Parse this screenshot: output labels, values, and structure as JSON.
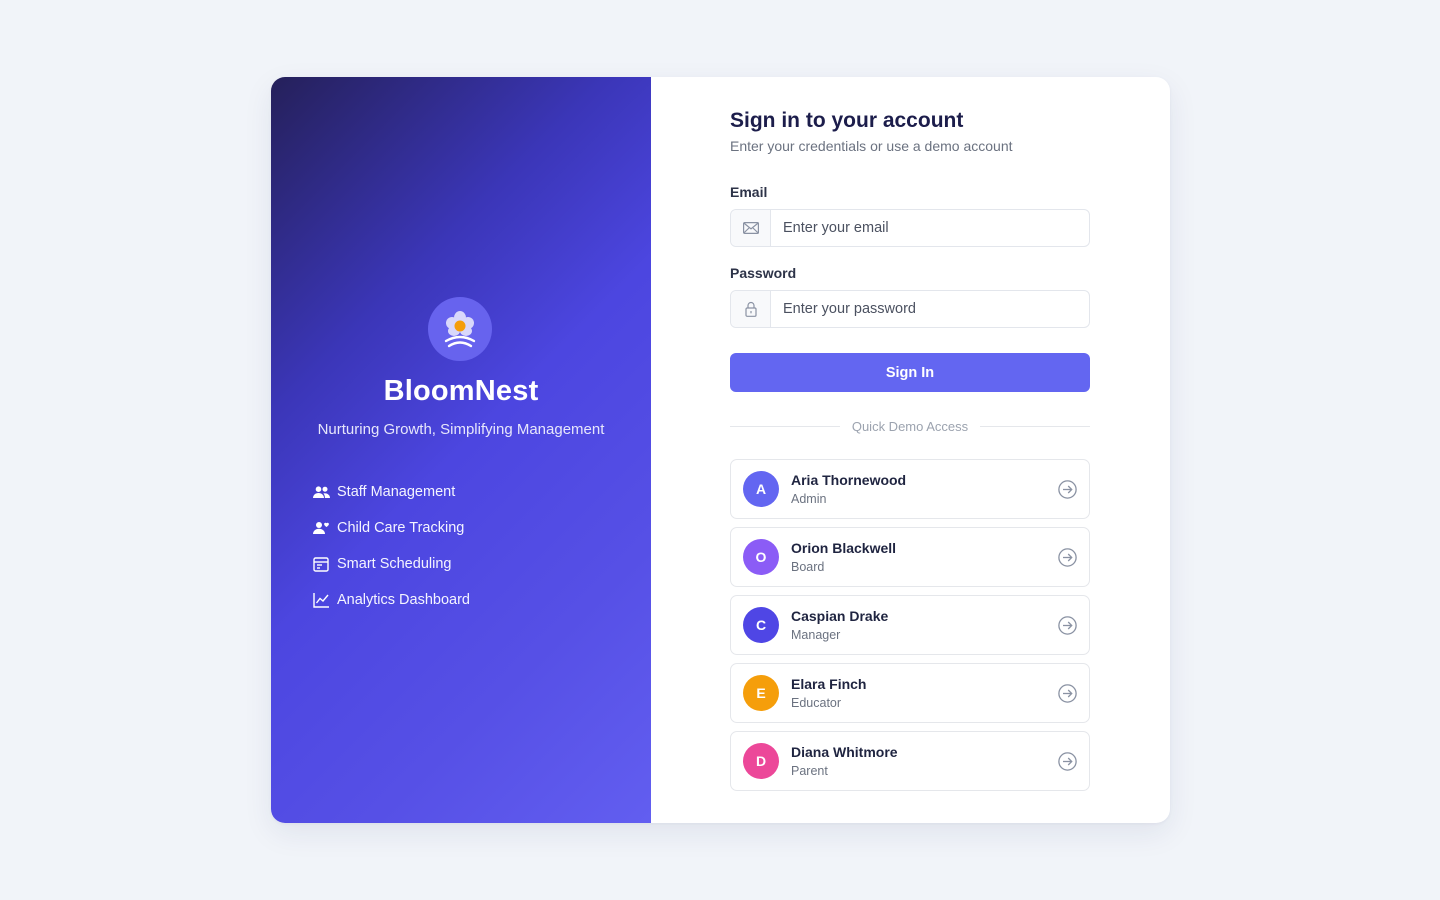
{
  "brand": {
    "name": "BloomNest",
    "tagline": "Nurturing Growth, Simplifying Management",
    "features": [
      {
        "label": "Staff Management",
        "icon": "users-icon"
      },
      {
        "label": "Child Care Tracking",
        "icon": "user-heart-icon"
      },
      {
        "label": "Smart Scheduling",
        "icon": "calendar-icon"
      },
      {
        "label": "Analytics Dashboard",
        "icon": "chart-line-icon"
      }
    ]
  },
  "form": {
    "title": "Sign in to your account",
    "subtitle": "Enter your credentials or use a demo account",
    "email": {
      "label": "Email",
      "placeholder": "Enter your email",
      "value": ""
    },
    "password": {
      "label": "Password",
      "placeholder": "Enter your password",
      "value": ""
    },
    "signin_label": "Sign In",
    "divider_label": "Quick Demo Access"
  },
  "demo_accounts": [
    {
      "initial": "A",
      "name": "Aria Thornewood",
      "role": "Admin",
      "color": "#6366f1"
    },
    {
      "initial": "O",
      "name": "Orion Blackwell",
      "role": "Board",
      "color": "#8b5cf6"
    },
    {
      "initial": "C",
      "name": "Caspian Drake",
      "role": "Manager",
      "color": "#4f46e5"
    },
    {
      "initial": "E",
      "name": "Elara Finch",
      "role": "Educator",
      "color": "#f59e0b"
    },
    {
      "initial": "D",
      "name": "Diana Whitmore",
      "role": "Parent",
      "color": "#ec4899"
    }
  ],
  "colors": {
    "accent": "#6366f1",
    "logo_center": "#f59e0b"
  }
}
